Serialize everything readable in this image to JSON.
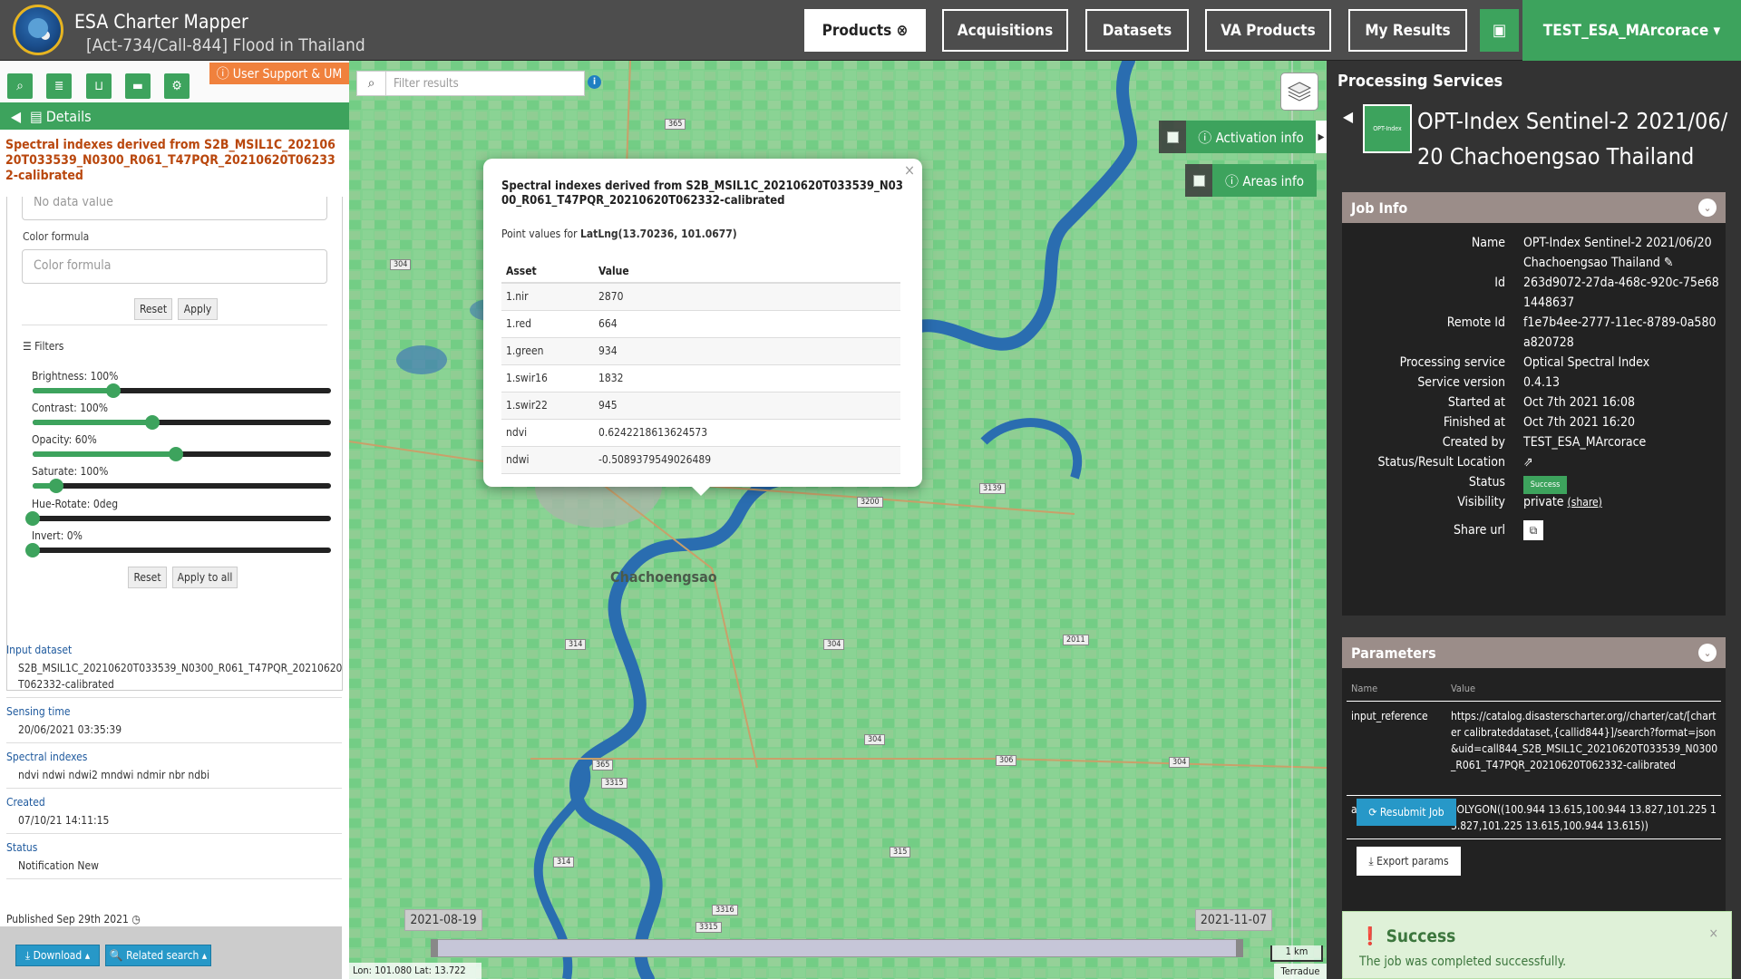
{
  "app": {
    "title": "ESA Charter Mapper",
    "subtitle": "[Act-734/Call-844] Flood in Thailand"
  },
  "nav": {
    "products": "Products",
    "acquisitions": "Acquisitions",
    "datasets": "Datasets",
    "va_products": "VA Products",
    "my_results": "My Results",
    "user": "TEST_ESA_MArcorace ▾"
  },
  "left": {
    "support": "ⓘ User Support & UM",
    "details_label": "Details",
    "title": "Spectral indexes derived from S2B_MSIL1C_20210620T033539_N0300_R061_T47PQR_20210620T062332-calibrated",
    "no_data_placeholder": "No data value",
    "color_formula_label": "Color formula",
    "color_formula_placeholder": "Color formula",
    "reset": "Reset",
    "apply": "Apply",
    "filters_label": "Filters",
    "sliders": [
      {
        "label": "Brightness: 100%",
        "fraction": 0.27
      },
      {
        "label": "Contrast: 100%",
        "fraction": 0.4
      },
      {
        "label": "Opacity: 60%",
        "fraction": 0.48
      },
      {
        "label": "Saturate: 100%",
        "fraction": 0.08
      },
      {
        "label": "Hue-Rotate: 0deg",
        "fraction": 0.0
      },
      {
        "label": "Invert: 0%",
        "fraction": 0.0
      }
    ],
    "reset2": "Reset",
    "apply_all": "Apply to all",
    "meta": {
      "input_label": "Input dataset",
      "input_value": "S2B_MSIL1C_20210620T033539_N0300_R061_T47PQR_20210620T062332-calibrated",
      "sensing_label": "Sensing time",
      "sensing_value": "20/06/2021 03:35:39",
      "indexes_label": "Spectral indexes",
      "indexes_value": "ndvi ndwi ndwi2 mndwi ndmir nbr ndbi",
      "created_label": "Created",
      "created_value": "07/10/21 14:11:15",
      "status_label": "Status",
      "status_value": "Notification New"
    },
    "published": "Published Sep 29th 2021",
    "download": "⤓ Download ▴",
    "related": "🔍 Related search ▴"
  },
  "map": {
    "filter_placeholder": "Filter results",
    "activation": "ⓘ Activation info",
    "areas": "ⓘ Areas info",
    "town": "Chachoengsao",
    "roads": [
      "365",
      "304",
      "3139",
      "3200",
      "314",
      "304",
      "2011",
      "365",
      "3315",
      "304",
      "306",
      "304",
      "314",
      "315",
      "3316",
      "3315"
    ],
    "date_start": "2021-08-19",
    "date_end": "2021-11-07",
    "scale": "1 km",
    "coords": "Lon: 101.080 Lat: 13.722",
    "attribution": "Terradue",
    "popup": {
      "title": "Spectral indexes derived from S2B_MSIL1C_20210620T033539_N0300_R061_T47PQR_20210620T062332-calibrated",
      "subtitle_prefix": "Point values for ",
      "subtitle_coord": "LatLng(13.70236, 101.0677)",
      "headers": [
        "Asset",
        "Value"
      ],
      "rows": [
        [
          "1.nir",
          "2870"
        ],
        [
          "1.red",
          "664"
        ],
        [
          "1.green",
          "934"
        ],
        [
          "1.swir16",
          "1832"
        ],
        [
          "1.swir22",
          "945"
        ],
        [
          "ndvi",
          "0.6242218613624573"
        ],
        [
          "ndwi",
          "-0.5089379549026489"
        ]
      ]
    }
  },
  "right": {
    "title": "Processing Services",
    "icon_text": "OPT-Index",
    "job_name": "OPT-Index Sentinel-2 2021/06/20 Chachoengsao Thailand",
    "job_info_label": "Job Info",
    "fields": {
      "name_k": "Name",
      "name_v": "OPT-Index Sentinel-2 2021/06/20 Chachoengsao Thailand ✎",
      "id_k": "Id",
      "id_v": "263d9072-27da-468c-920c-75e681448637",
      "remote_k": "Remote Id",
      "remote_v": "f1e7b4ee-2777-11ec-8789-0a580a820728",
      "service_k": "Processing service",
      "service_v": "Optical Spectral Index",
      "version_k": "Service version",
      "version_v": "0.4.13",
      "started_k": "Started at",
      "started_v": "Oct 7th 2021 16:08",
      "finished_k": "Finished at",
      "finished_v": "Oct 7th 2021 16:20",
      "created_k": "Created by",
      "created_v": "TEST_ESA_MArcorace",
      "location_k": "Status/Result Location",
      "status_k": "Status",
      "status_v": "Success",
      "visibility_k": "Visibility",
      "visibility_v": "private",
      "share_link": "(share)",
      "share_k": "Share url"
    },
    "params_label": "Parameters",
    "param_headers": [
      "Name",
      "Value"
    ],
    "params": [
      {
        "name": "input_reference",
        "value": "https://catalog.disasterscharter.org//charter/cat/[charter calibrateddataset,{callid844}]/search?format=json&uid=call844_S2B_MSIL1C_20210620T033539_N0300_R061_T47PQR_20210620T062332-calibrated"
      },
      {
        "name": "aoi",
        "value": "POLYGON((100.944 13.615,100.944 13.827,101.225 13.827,101.225 13.615,100.944 13.615))"
      }
    ],
    "resubmit": "⟳ Resubmit Job",
    "export": "⤓ Export params",
    "success_title": "Success",
    "success_text": "The job was completed successfully."
  }
}
